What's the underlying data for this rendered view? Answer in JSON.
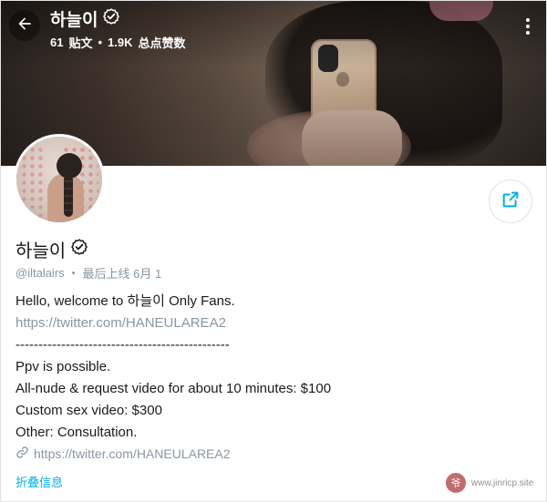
{
  "header": {
    "title": "하늘이",
    "posts_count": "61",
    "posts_label": "贴文",
    "separator": "•",
    "likes_count": "1.9K",
    "likes_label": "总点赞数"
  },
  "icons": {
    "back": "arrow-left-icon",
    "verified": "verified-badge-icon",
    "more": "more-vertical-icon",
    "share": "share-icon",
    "link": "link-icon"
  },
  "colors": {
    "accent": "#00aff0",
    "muted": "#8a96a3",
    "text": "#1a1a1a"
  },
  "profile": {
    "name": "하늘이",
    "handle": "@iltalairs",
    "separator": "•",
    "last_online": "最后上线 6月 1"
  },
  "bio": {
    "lines": [
      "Hello, welcome to 하늘이 Only Fans.",
      "https://twitter.com/HANEULAREA2",
      "-----------------------------------------------",
      "Ppv is possible.",
      "All-nude & request video for about 10 minutes: $100",
      "Custom sex video: $300",
      "Other: Consultation."
    ]
  },
  "website": {
    "url": "https://twitter.com/HANEULAREA2"
  },
  "actions": {
    "collapse_label": "折叠信息"
  },
  "watermark": {
    "seal": "爷",
    "text": "www.jinricp.site"
  }
}
